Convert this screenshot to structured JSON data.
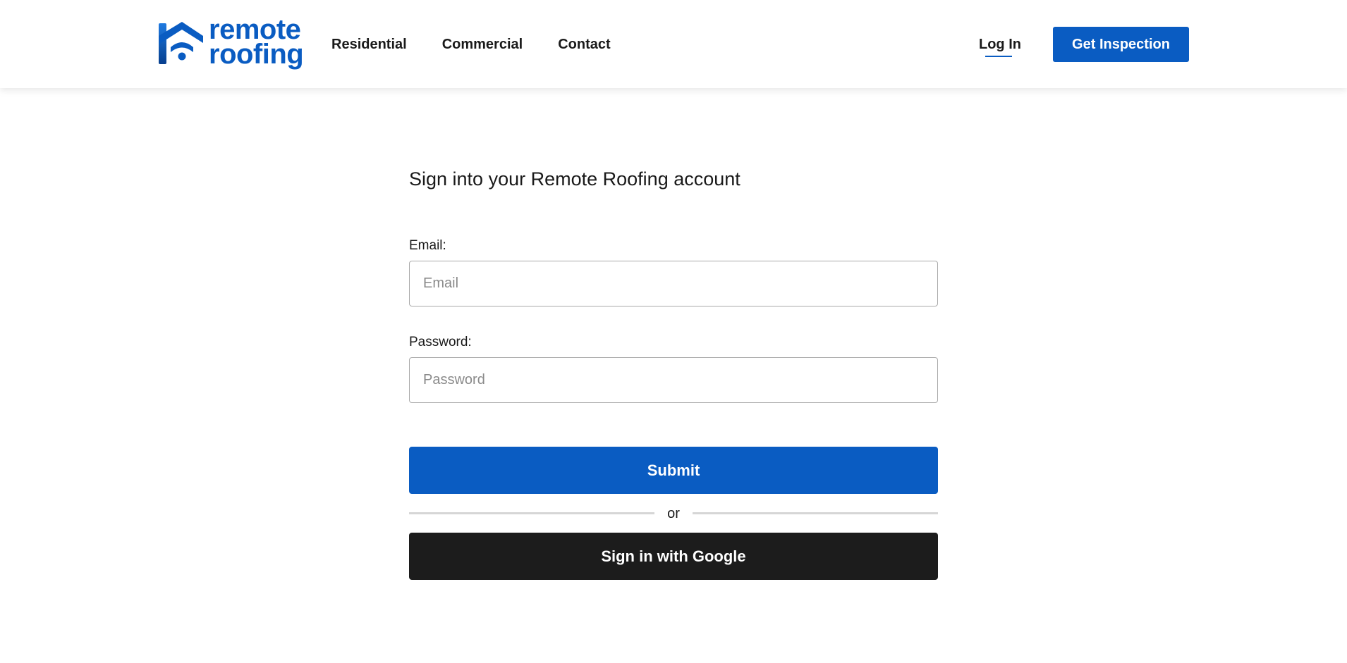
{
  "brand": {
    "line1": "remote",
    "line2": "roofing",
    "color": "#0a5cc2",
    "icon": "house-wifi-icon"
  },
  "nav": {
    "items": [
      {
        "label": "Residential"
      },
      {
        "label": "Commercial"
      },
      {
        "label": "Contact"
      }
    ],
    "login_label": "Log In",
    "cta_label": "Get Inspection"
  },
  "form": {
    "title": "Sign into your Remote Roofing account",
    "email": {
      "label": "Email:",
      "placeholder": "Email",
      "value": ""
    },
    "password": {
      "label": "Password:",
      "placeholder": "Password",
      "value": ""
    },
    "submit_label": "Submit",
    "divider_text": "or",
    "google_label": "Sign in with Google"
  },
  "colors": {
    "primary": "#0a5cc2",
    "dark_button": "#1c1c1c",
    "divider": "#d6d6d6"
  }
}
